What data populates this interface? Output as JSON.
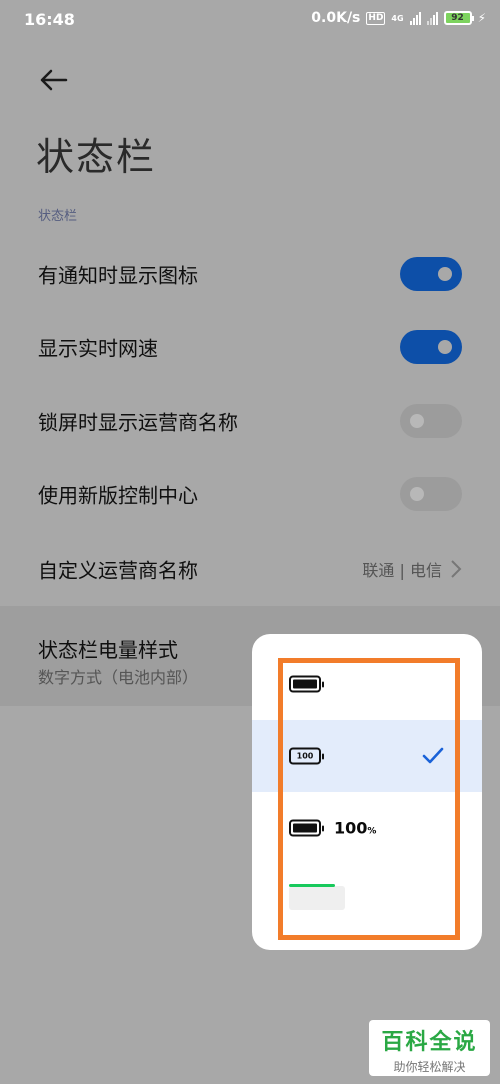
{
  "status_bar": {
    "time": "16:48",
    "net_speed": "0.0K/s",
    "hd_badge": "HD",
    "net_type": "4G",
    "battery": "92"
  },
  "header": {
    "title": "状态栏"
  },
  "section": {
    "label": "状态栏"
  },
  "rows": [
    {
      "label": "有通知时显示图标",
      "toggle": "on"
    },
    {
      "label": "显示实时网速",
      "toggle": "on"
    },
    {
      "label": "锁屏时显示运营商名称",
      "toggle": "off"
    },
    {
      "label": "使用新版控制中心",
      "toggle": "off"
    },
    {
      "label": "自定义运营商名称",
      "value": "联通 | 电信"
    }
  ],
  "battery_style_row": {
    "title": "状态栏电量样式",
    "subtitle": "数字方式（电池内部）"
  },
  "popup": {
    "options": [
      {
        "style": "icon",
        "selected": false
      },
      {
        "style": "number-inside",
        "inner_text": "100",
        "selected": true
      },
      {
        "style": "icon-with-percent",
        "text": "100",
        "unit": "%",
        "selected": false
      },
      {
        "style": "top-line",
        "selected": false
      }
    ]
  },
  "watermark": {
    "title": "百科全说",
    "subtitle": "助你轻松解决"
  },
  "colors": {
    "accent": "#0d4fa8",
    "highlight_box": "#f27c2a",
    "watermark": "#2aa844"
  }
}
